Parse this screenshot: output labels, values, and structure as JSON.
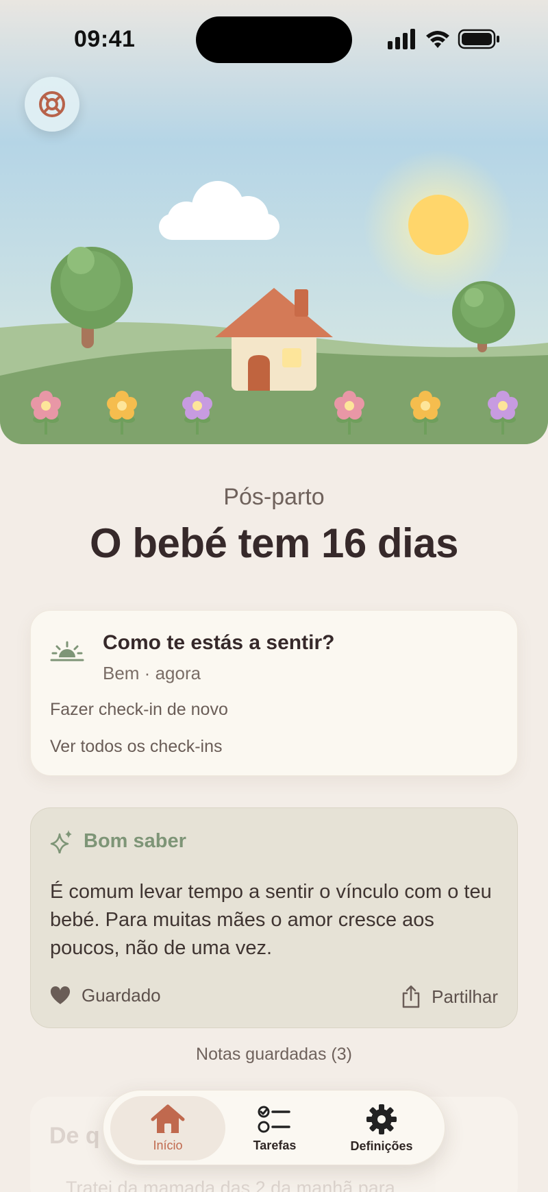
{
  "status_bar": {
    "time": "09:41"
  },
  "hero": {
    "help_button_icon": "lifebuoy-icon"
  },
  "header": {
    "phase": "Pós-parto",
    "headline": "O bebé tem 16 dias"
  },
  "checkin": {
    "icon": "sunrise-icon",
    "title": "Como te estás a sentir?",
    "subtitle": "Bem · agora",
    "redo_link": "Fazer check-in de novo",
    "all_link": "Ver todos os check-ins"
  },
  "tip": {
    "icon": "sparkle-icon",
    "label": "Bom saber",
    "body": "É comum levar tempo a sentir o vínculo com o teu bebé. Para muitas mães o amor cresce aos poucos, não de uma vez.",
    "saved_label": "Guardado",
    "share_label": "Partilhar"
  },
  "saved_notes": "Notas guardadas (3)",
  "next_card": {
    "title": "De q",
    "body": "Tratei da mamada das 2 da manhã para"
  },
  "tabs": [
    {
      "label": "Início",
      "icon": "home-icon",
      "active": true
    },
    {
      "label": "Tarefas",
      "icon": "checklist-icon",
      "active": false
    },
    {
      "label": "Definições",
      "icon": "gear-icon",
      "active": false
    }
  ],
  "colors": {
    "background": "#f3ede7",
    "accent": "#c0694e",
    "tip_accent": "#7e9577",
    "sky": "#bcd8e6",
    "grass": "#7fa36c"
  }
}
